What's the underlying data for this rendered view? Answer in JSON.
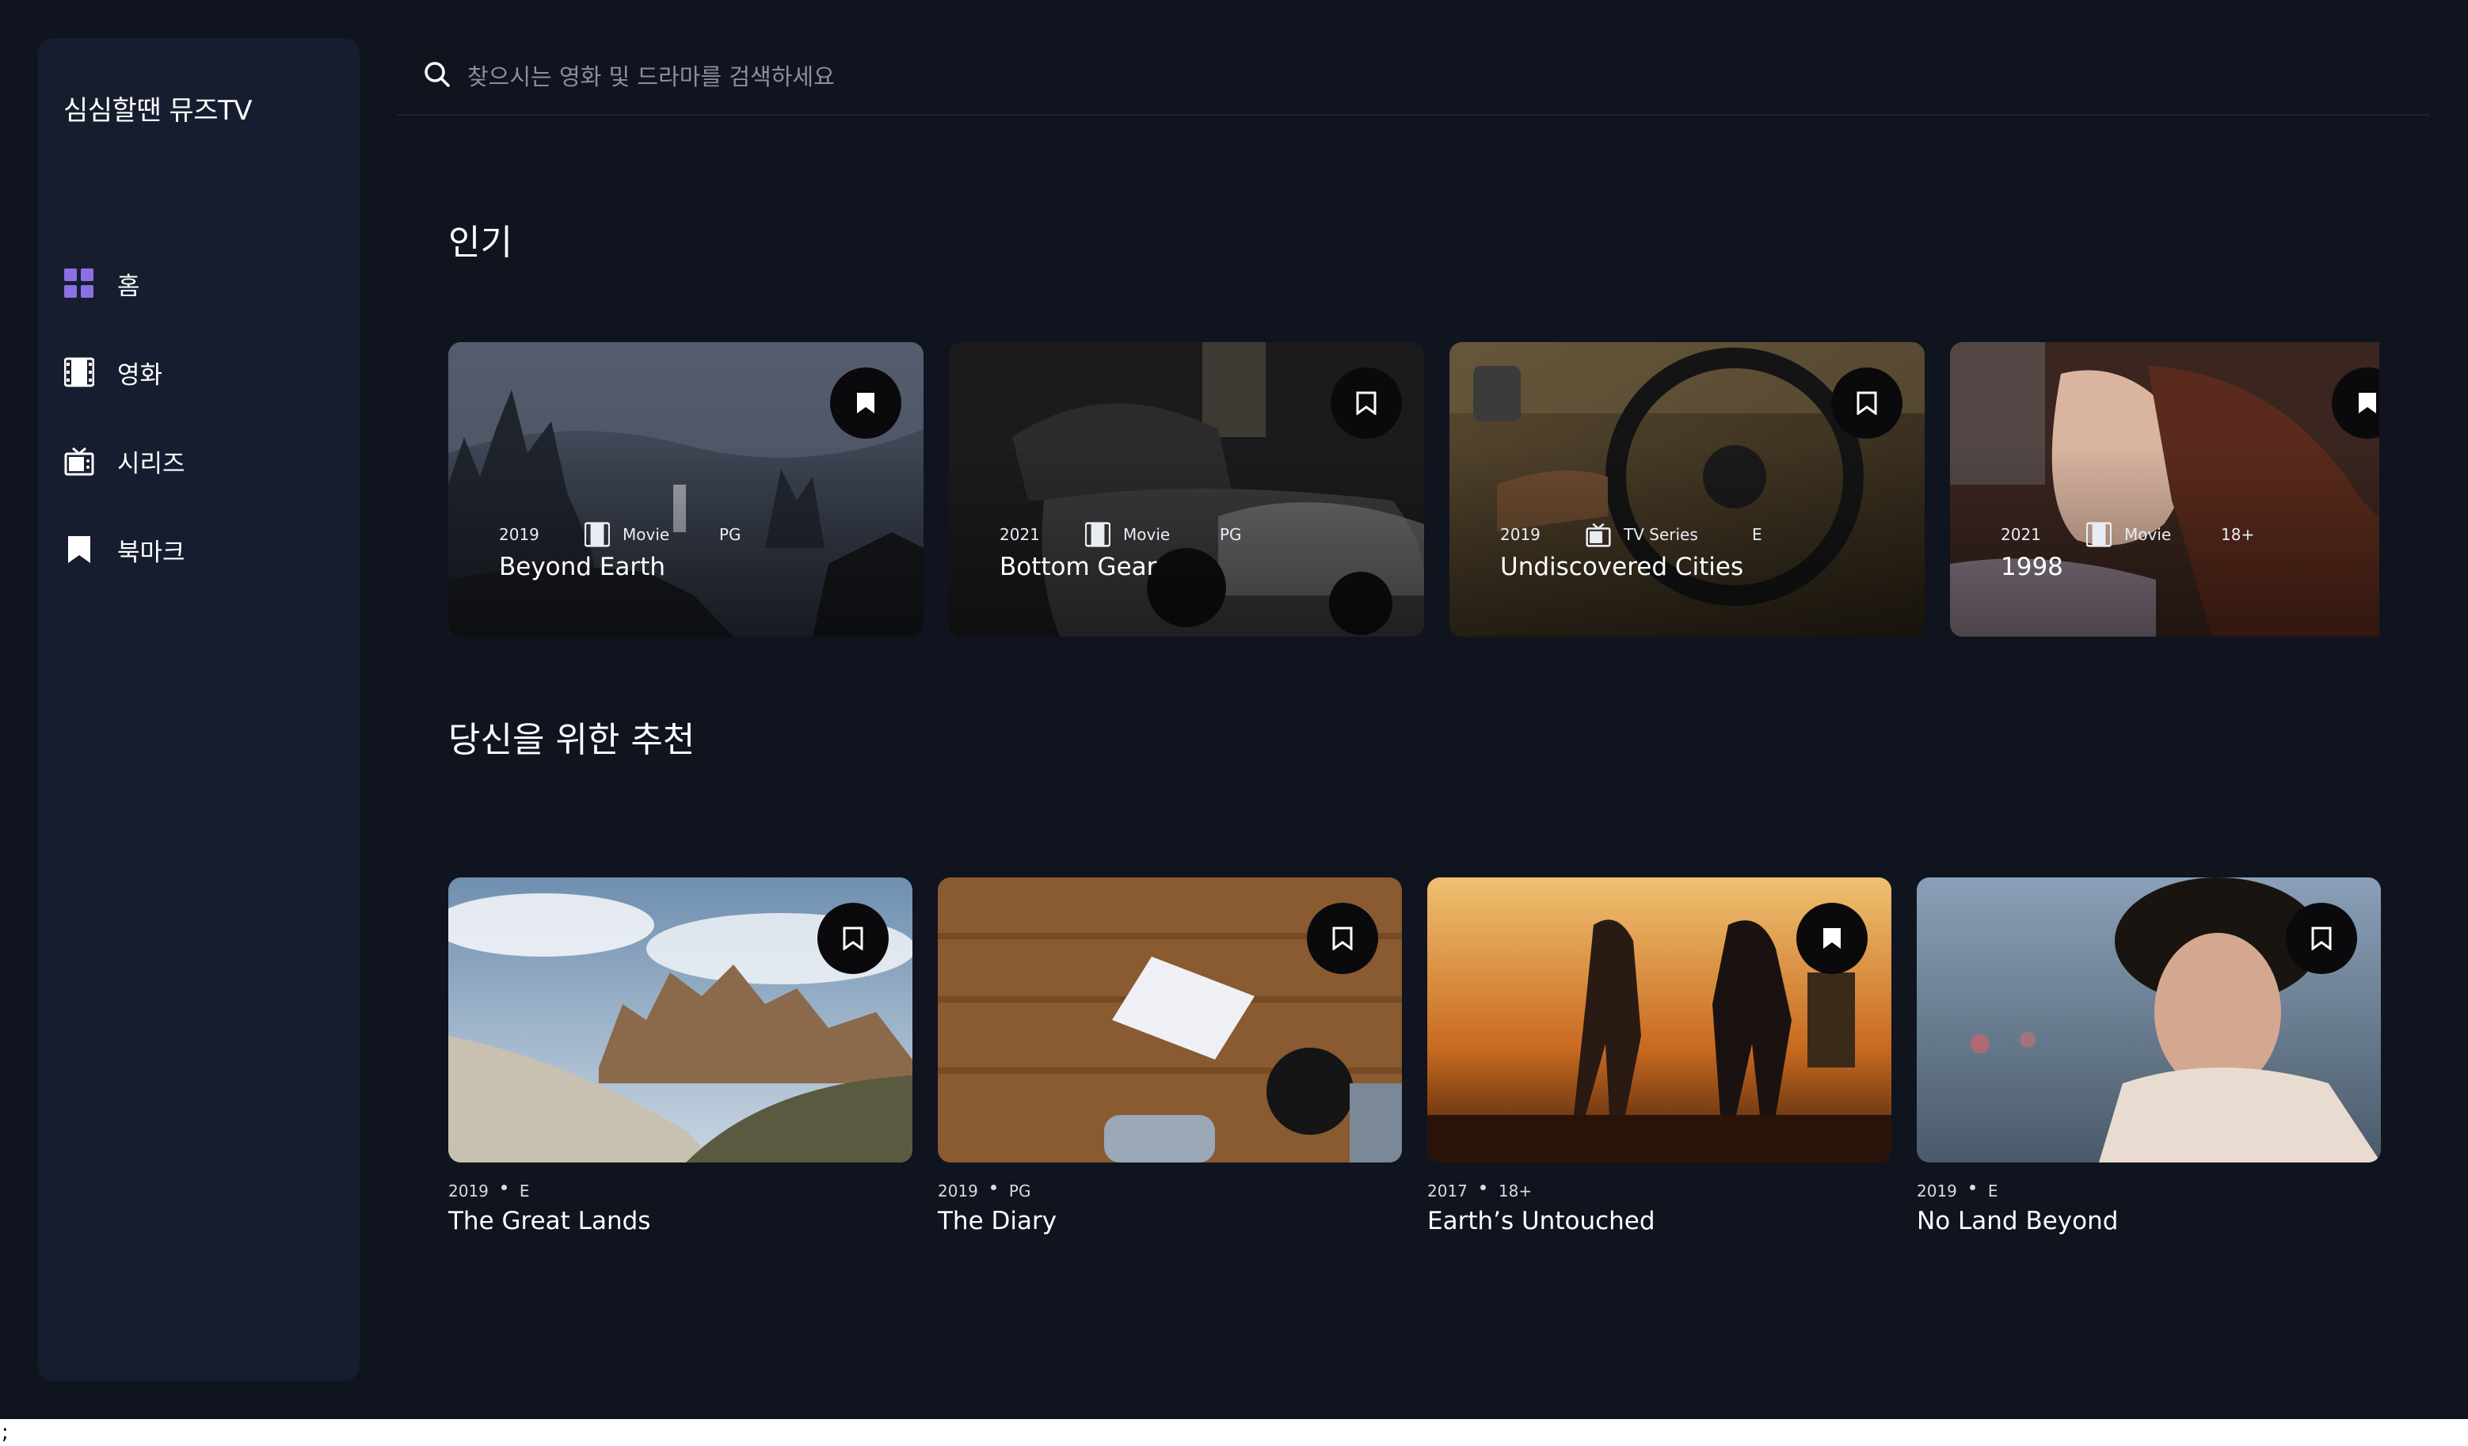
{
  "app": {
    "title": "심심할땐 뮤즈TV"
  },
  "sidebar": {
    "items": [
      {
        "label": "홈",
        "icon": "grid-icon",
        "active": true
      },
      {
        "label": "영화",
        "icon": "film-icon"
      },
      {
        "label": "시리즈",
        "icon": "tv-icon"
      },
      {
        "label": "북마크",
        "icon": "bookmark-icon"
      }
    ]
  },
  "search": {
    "placeholder": "찾으시는 영화 및 드라마를 검색하세요"
  },
  "trending": {
    "title": "인기",
    "items": [
      {
        "year": "2019",
        "category": "Movie",
        "rating": "PG",
        "title": "Beyond Earth"
      },
      {
        "year": "2021",
        "category": "Movie",
        "rating": "PG",
        "title": "Bottom Gear"
      },
      {
        "year": "2019",
        "category": "TV Series",
        "rating": "E",
        "title": "Undiscovered Cities"
      },
      {
        "year": "2021",
        "category": "Movie",
        "rating": "18+",
        "title": "1998"
      }
    ]
  },
  "recommended": {
    "title": "당신을 위한 추천",
    "items": [
      {
        "year": "2019",
        "rating": "E",
        "title": "The Great Lands"
      },
      {
        "year": "2019",
        "rating": "PG",
        "title": "The Diary"
      },
      {
        "year": "2017",
        "rating": "18+",
        "title": "Earth’s Untouched"
      },
      {
        "year": "2019",
        "rating": "E",
        "title": "No Land Beyond"
      }
    ]
  },
  "stray_text": ";",
  "colors": {
    "background": "#10141e",
    "sidebar": "#161d2f",
    "accent": "#8c6fe0",
    "bookmark_button": "#0a0a0c"
  }
}
